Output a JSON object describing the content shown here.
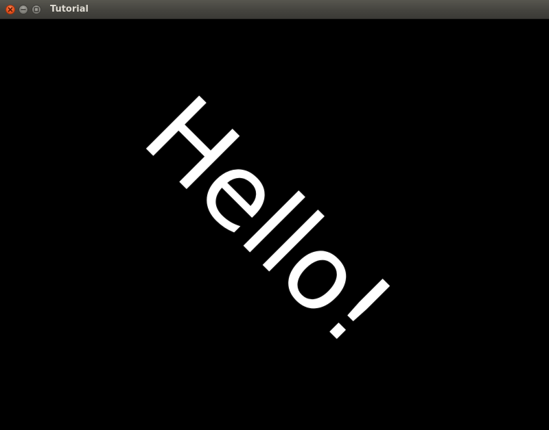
{
  "window": {
    "title": "Tutorial",
    "buttons": {
      "close": "close-icon",
      "minimize": "minimize-icon",
      "maximize": "maximize-icon"
    }
  },
  "canvas": {
    "text": "Hello!",
    "text_color": "#ffffff",
    "background_color": "#000000",
    "rotation_degrees": 45
  }
}
